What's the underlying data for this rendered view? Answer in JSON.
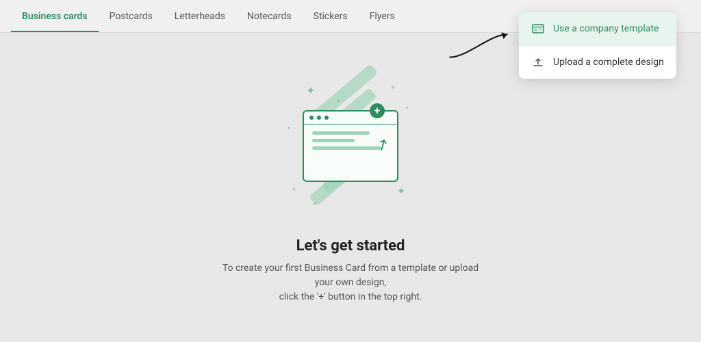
{
  "nav": {
    "tabs": [
      {
        "id": "business-cards",
        "label": "Business cards",
        "active": true
      },
      {
        "id": "postcards",
        "label": "Postcards",
        "active": false
      },
      {
        "id": "letterheads",
        "label": "Letterheads",
        "active": false
      },
      {
        "id": "notecards",
        "label": "Notecards",
        "active": false
      },
      {
        "id": "stickers",
        "label": "Stickers",
        "active": false
      },
      {
        "id": "flyers",
        "label": "Flyers",
        "active": false
      }
    ]
  },
  "dropdown": {
    "items": [
      {
        "id": "company-template",
        "label": "Use a company template",
        "icon": "template-icon",
        "highlighted": true
      },
      {
        "id": "upload-design",
        "label": "Upload a complete design",
        "icon": "upload-icon",
        "highlighted": false
      }
    ]
  },
  "main": {
    "heading": "Let's get started",
    "subtext": "To create your first Business Card from a template or upload your own design,\nclick the '+' button in the top right."
  },
  "colors": {
    "accent": "#2d8c5e",
    "light_accent": "#9fd4b8",
    "bg": "#e8e8e8"
  }
}
